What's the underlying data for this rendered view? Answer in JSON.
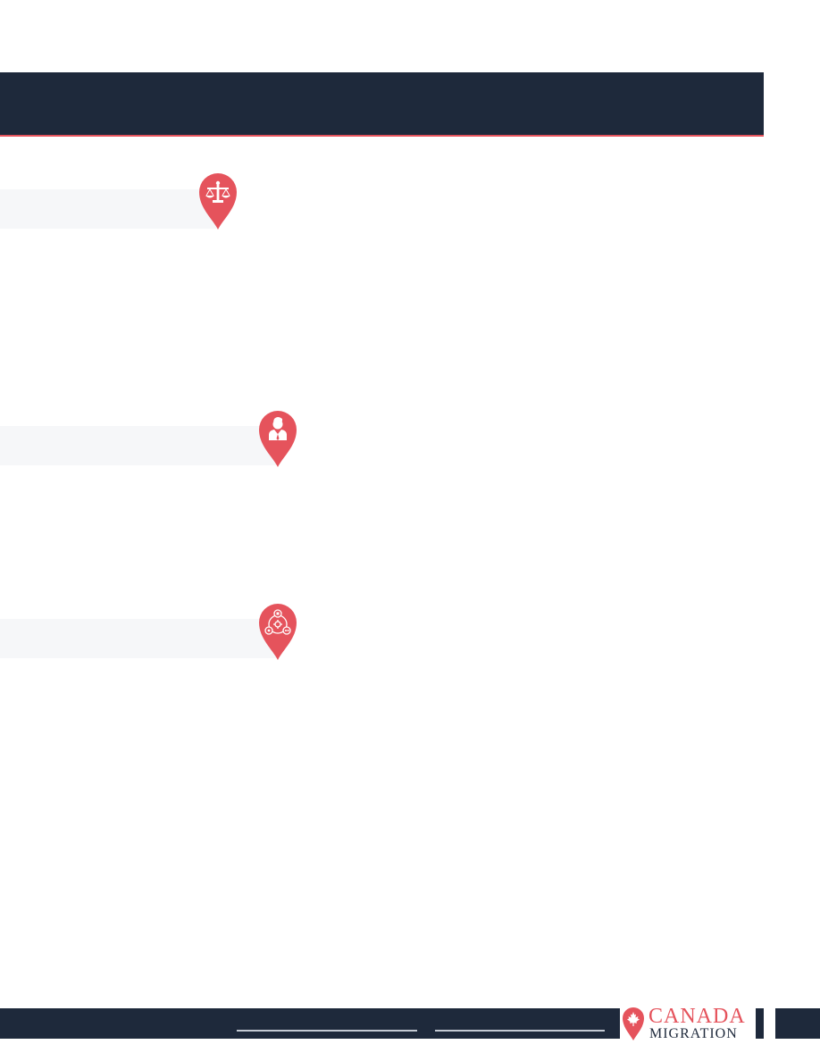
{
  "colors": {
    "accent": "#e5535c",
    "navy": "#1e293b",
    "bar_gray": "#f6f7f9",
    "rule_gray": "#c4cad3"
  },
  "sections": [
    {
      "icon": "scales-of-justice-icon"
    },
    {
      "icon": "consultant-person-icon"
    },
    {
      "icon": "network-process-icon"
    }
  ],
  "logo": {
    "line1": "CANADA",
    "line2": "MIGRATION",
    "icon": "maple-leaf-pin-icon"
  }
}
